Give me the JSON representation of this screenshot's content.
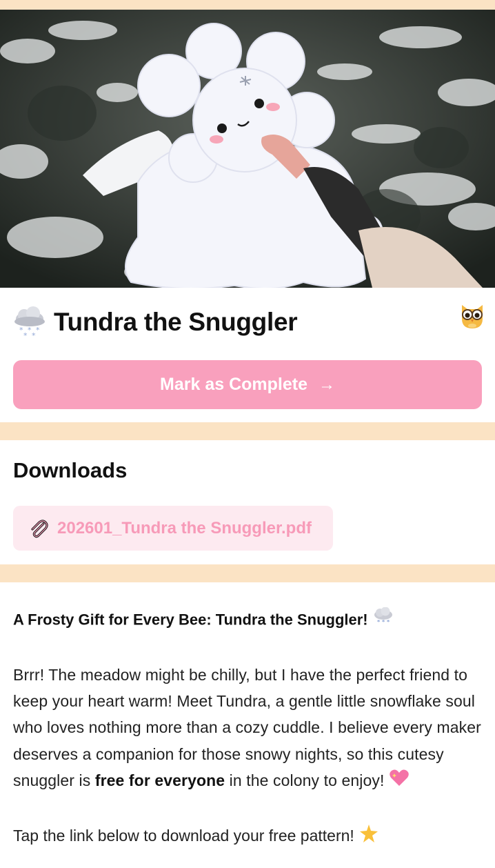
{
  "page": {
    "title": "Tundra the Snuggler",
    "title_icon": "cloud-snow-icon",
    "owl_icon": "owl-avatar-icon"
  },
  "actions": {
    "complete_label": "Mark as Complete",
    "complete_arrow": "→",
    "complete_color": "#f9a0bd"
  },
  "downloads": {
    "heading": "Downloads",
    "files": [
      {
        "name": "202601_Tundra the Snuggler.pdf",
        "icon": "paperclip-icon"
      }
    ]
  },
  "article": {
    "heading": "A Frosty Gift for Every Bee: Tundra the Snuggler!",
    "p1_before": "Brrr! The meadow might be chilly, but I have the perfect friend to keep your heart warm! Meet Tundra, a gentle little snowflake soul who loves nothing more than a cozy cuddle. I believe every maker deserves a companion for those snowy nights, so this cutesy snuggler is",
    "p1_bold": "free for everyone",
    "p1_after": "in the colony to enjoy!",
    "p2": "Tap the link below to download your free pattern!"
  },
  "colors": {
    "band": "#fbe3c4",
    "accent_pink": "#f9a0bd",
    "chip_bg": "#fdeaf0",
    "chip_text": "#f79ab8"
  }
}
